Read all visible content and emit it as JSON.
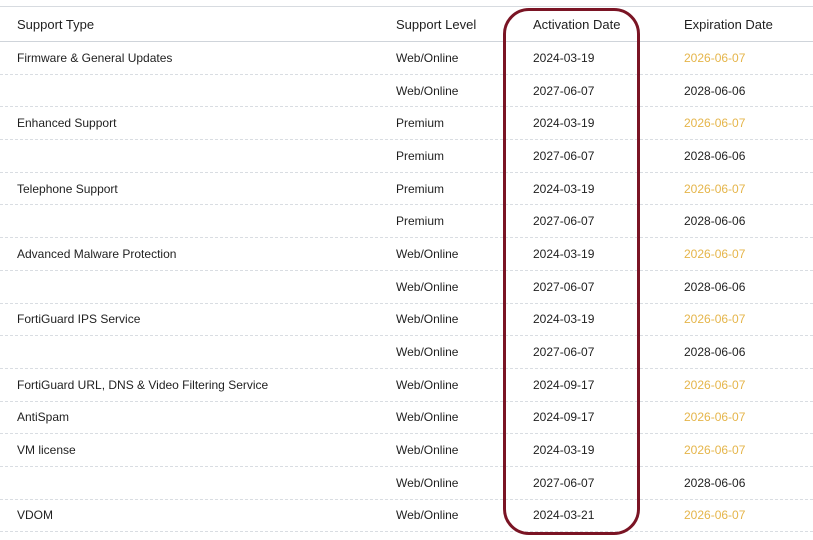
{
  "headers": {
    "support_type": "Support Type",
    "support_level": "Support Level",
    "activation_date": "Activation Date",
    "expiration_date": "Expiration Date"
  },
  "rows": [
    {
      "type": "Firmware & General Updates",
      "level": "Web/Online",
      "activation": "2024-03-19",
      "expiration": "2026-06-07",
      "expiring": true
    },
    {
      "type": "",
      "level": "Web/Online",
      "activation": "2027-06-07",
      "expiration": "2028-06-06",
      "expiring": false
    },
    {
      "type": "Enhanced Support",
      "level": "Premium",
      "activation": "2024-03-19",
      "expiration": "2026-06-07",
      "expiring": true
    },
    {
      "type": "",
      "level": "Premium",
      "activation": "2027-06-07",
      "expiration": "2028-06-06",
      "expiring": false
    },
    {
      "type": "Telephone Support",
      "level": "Premium",
      "activation": "2024-03-19",
      "expiration": "2026-06-07",
      "expiring": true
    },
    {
      "type": "",
      "level": "Premium",
      "activation": "2027-06-07",
      "expiration": "2028-06-06",
      "expiring": false
    },
    {
      "type": "Advanced Malware Protection",
      "level": "Web/Online",
      "activation": "2024-03-19",
      "expiration": "2026-06-07",
      "expiring": true
    },
    {
      "type": "",
      "level": "Web/Online",
      "activation": "2027-06-07",
      "expiration": "2028-06-06",
      "expiring": false
    },
    {
      "type": "FortiGuard IPS Service",
      "level": "Web/Online",
      "activation": "2024-03-19",
      "expiration": "2026-06-07",
      "expiring": true
    },
    {
      "type": "",
      "level": "Web/Online",
      "activation": "2027-06-07",
      "expiration": "2028-06-06",
      "expiring": false
    },
    {
      "type": "FortiGuard URL, DNS & Video Filtering Service",
      "level": "Web/Online",
      "activation": "2024-09-17",
      "expiration": "2026-06-07",
      "expiring": true
    },
    {
      "type": "AntiSpam",
      "level": "Web/Online",
      "activation": "2024-09-17",
      "expiration": "2026-06-07",
      "expiring": true
    },
    {
      "type": "VM license",
      "level": "Web/Online",
      "activation": "2024-03-19",
      "expiration": "2026-06-07",
      "expiring": true
    },
    {
      "type": "",
      "level": "Web/Online",
      "activation": "2027-06-07",
      "expiration": "2028-06-06",
      "expiring": false
    },
    {
      "type": "VDOM",
      "level": "Web/Online",
      "activation": "2024-03-21",
      "expiration": "2026-06-07",
      "expiring": true
    }
  ],
  "colors": {
    "expiring_text": "#e5b54a",
    "highlight_border": "#7a1424"
  }
}
